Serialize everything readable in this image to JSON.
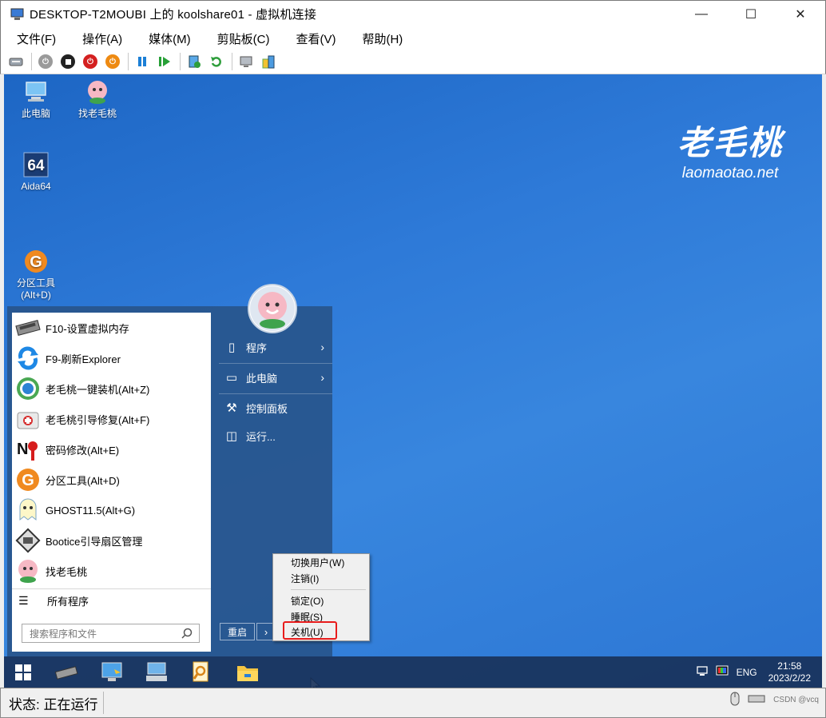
{
  "window": {
    "title": "DESKTOP-T2MOUBI 上的 koolshare01 - 虚拟机连接",
    "minimize": "—",
    "maximize": "☐",
    "close": "✕"
  },
  "menu": [
    "文件(F)",
    "操作(A)",
    "媒体(M)",
    "剪贴板(C)",
    "查看(V)",
    "帮助(H)"
  ],
  "toolbar": {
    "icons": [
      "ctrl-alt-del-icon",
      "start-icon",
      "turn-off-icon",
      "shutdown-icon",
      "power-reset-icon",
      "pause-icon",
      "resume-icon",
      "checkpoint-icon",
      "revert-icon",
      "enhanced-session-icon",
      "share-icon"
    ]
  },
  "desktop": {
    "brand_cn": "老毛桃",
    "brand_en": "laomaotao.net",
    "icons": [
      {
        "label": "此电脑",
        "icon": "computer-icon"
      },
      {
        "label": "找老毛桃",
        "icon": "peach-icon"
      },
      {
        "label": "Aida64",
        "icon": "aida64-icon"
      },
      {
        "label": "分区工具\n(Alt+D)",
        "icon": "diskgenius-icon"
      }
    ]
  },
  "startmenu": {
    "programs": [
      {
        "label": "F10-设置虚拟内存",
        "icon": "memory-chip-icon"
      },
      {
        "label": "F9-刷新Explorer",
        "icon": "refresh-icon"
      },
      {
        "label": "老毛桃一键装机(Alt+Z)",
        "icon": "installer-icon"
      },
      {
        "label": "老毛桃引导修复(Alt+F)",
        "icon": "first-aid-icon"
      },
      {
        "label": "密码修改(Alt+E)",
        "icon": "nt-password-icon"
      },
      {
        "label": "分区工具(Alt+D)",
        "icon": "diskgenius-icon"
      },
      {
        "label": "GHOST11.5(Alt+G)",
        "icon": "ghost-icon"
      },
      {
        "label": "Bootice引导扇区管理",
        "icon": "bootice-icon"
      },
      {
        "label": "找老毛桃",
        "icon": "peach-icon"
      }
    ],
    "all_programs": "所有程序",
    "search_placeholder": "搜索程序和文件",
    "right_items": [
      {
        "label": "程序",
        "icon": "document-icon",
        "arrow": "›"
      },
      {
        "label": "此电脑",
        "icon": "laptop-icon",
        "arrow": "›"
      },
      {
        "label": "控制面板",
        "icon": "wrench-icon"
      },
      {
        "label": "运行...",
        "icon": "run-icon"
      }
    ],
    "restart": "重启",
    "restart_arrow": "›"
  },
  "context_menu": {
    "items": [
      "切换用户(W)",
      "注销(I)",
      "锁定(O)",
      "睡眠(S)",
      "关机(U)"
    ],
    "highlighted": "关机(U)",
    "highlight_color": "#e81c1c"
  },
  "taskbar": {
    "tray_lang": "ENG",
    "time": "21:58",
    "date": "2023/2/22"
  },
  "status": {
    "text": "状态: 正在运行",
    "watermark": "CSDN @vcq"
  }
}
